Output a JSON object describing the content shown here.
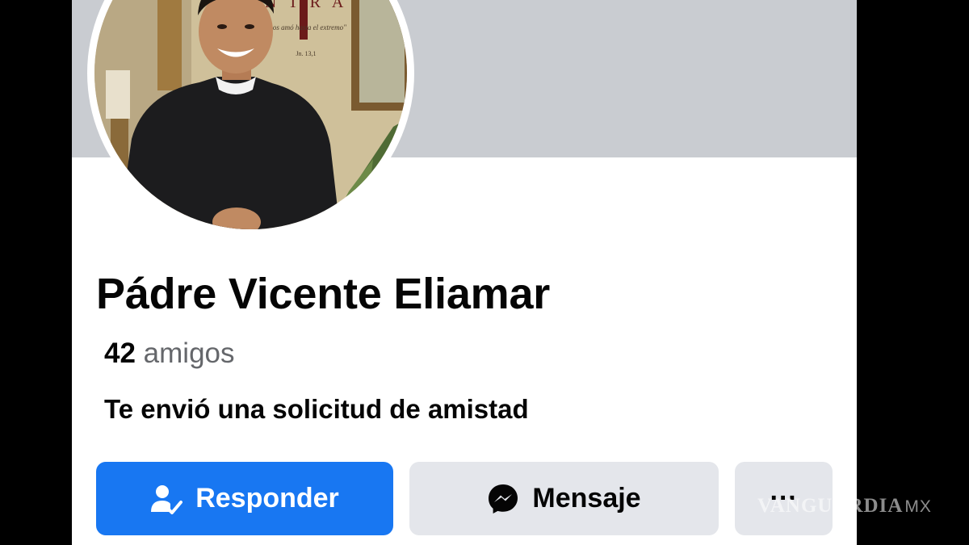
{
  "profile": {
    "name": "Pádre Vicente Eliamar",
    "friends_count": "42",
    "friends_label": "amigos",
    "request_status": "Te envió una solicitud de amistad"
  },
  "avatar": {
    "sign_letters": "N T R A",
    "sign_motto": "\"Los amó hasta el extremo\"",
    "sign_reference": "Jn. 13,1"
  },
  "actions": {
    "respond_label": "Responder",
    "message_label": "Mensaje",
    "more_label": "···"
  },
  "watermark": {
    "brand": "VANGUARDIA",
    "suffix": "MX"
  },
  "colors": {
    "primary": "#1877f2",
    "secondary_button": "#e4e6eb",
    "cover": "#c9ccd1",
    "text_primary": "#050505",
    "text_secondary": "#65676b",
    "frame": "#000000"
  },
  "icons": {
    "respond": "user-check-icon",
    "message": "messenger-icon",
    "more": "more-dots-icon"
  }
}
